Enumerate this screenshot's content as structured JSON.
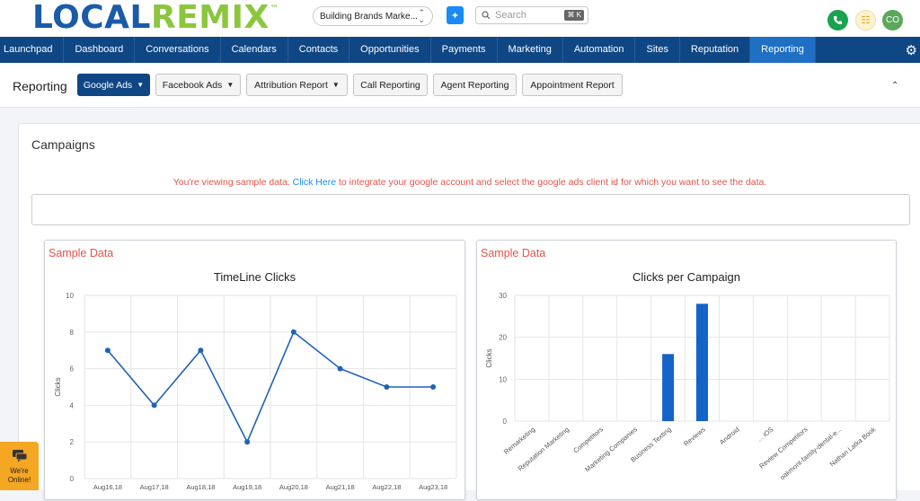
{
  "logo": {
    "part1": "LOCAL",
    "part2": "REMIX",
    "tm": "™"
  },
  "header": {
    "account": "Building Brands Marke...",
    "search_placeholder": "Search",
    "search_shortcut": "⌘ K",
    "avatar_initials": "CO"
  },
  "nav": {
    "items": [
      "Launchpad",
      "Dashboard",
      "Conversations",
      "Calendars",
      "Contacts",
      "Opportunities",
      "Payments",
      "Marketing",
      "Automation",
      "Sites",
      "Reputation",
      "Reporting"
    ],
    "active": "Reporting"
  },
  "reporting_bar": {
    "title": "Reporting",
    "google_ads": "Google Ads",
    "facebook_ads": "Facebook Ads",
    "attribution_report": "Attribution Report",
    "call_reporting": "Call Reporting",
    "agent_reporting": "Agent Reporting",
    "appointment_report": "Appointment Report"
  },
  "campaigns": {
    "title": "Campaigns",
    "notice_before": "You're viewing sample data. ",
    "notice_link": "Click Here",
    "notice_after": " to integrate your google account and select the google ads client id for which you want to see the data."
  },
  "panels": {
    "sample_label": "Sample Data"
  },
  "chat": {
    "label": "We're Online!"
  },
  "colors": {
    "brand_blue": "#1a5ba8",
    "brand_green": "#8cc63f",
    "nav_bg": "#0f4684",
    "nav_active": "#1f6fc4",
    "sample_red": "#e5534b",
    "series_blue": "#1f63b8"
  },
  "chart_data": [
    {
      "type": "line",
      "title": "TimeLine Clicks",
      "ylabel": "Clicks",
      "x": [
        "Aug16,18",
        "Aug17,18",
        "Aug18,18",
        "Aug19,18",
        "Aug20,18",
        "Aug21,18",
        "Aug22,18",
        "Aug23,18"
      ],
      "values": [
        7,
        4,
        7,
        2,
        8,
        6,
        5,
        5
      ],
      "ylim": [
        0,
        10
      ],
      "yticks": [
        0,
        2,
        4,
        6,
        8,
        10
      ],
      "grid": true
    },
    {
      "type": "bar",
      "title": "Clicks per Campaign",
      "ylabel": "Clicks",
      "categories": [
        "Remarketing",
        "Reputation Marketing",
        "Competitors",
        "Marketing Companies",
        "Business Texting",
        "Reviews",
        "Android",
        "... iOS",
        "Review Competitors",
        "oakmont-family-dental-e...",
        "Nathan Latka Book"
      ],
      "values": [
        0,
        0,
        0,
        0,
        16,
        28,
        0,
        0,
        0,
        0,
        0
      ],
      "ylim": [
        0,
        30
      ],
      "yticks": [
        0,
        10,
        20,
        30
      ],
      "grid": true
    }
  ]
}
